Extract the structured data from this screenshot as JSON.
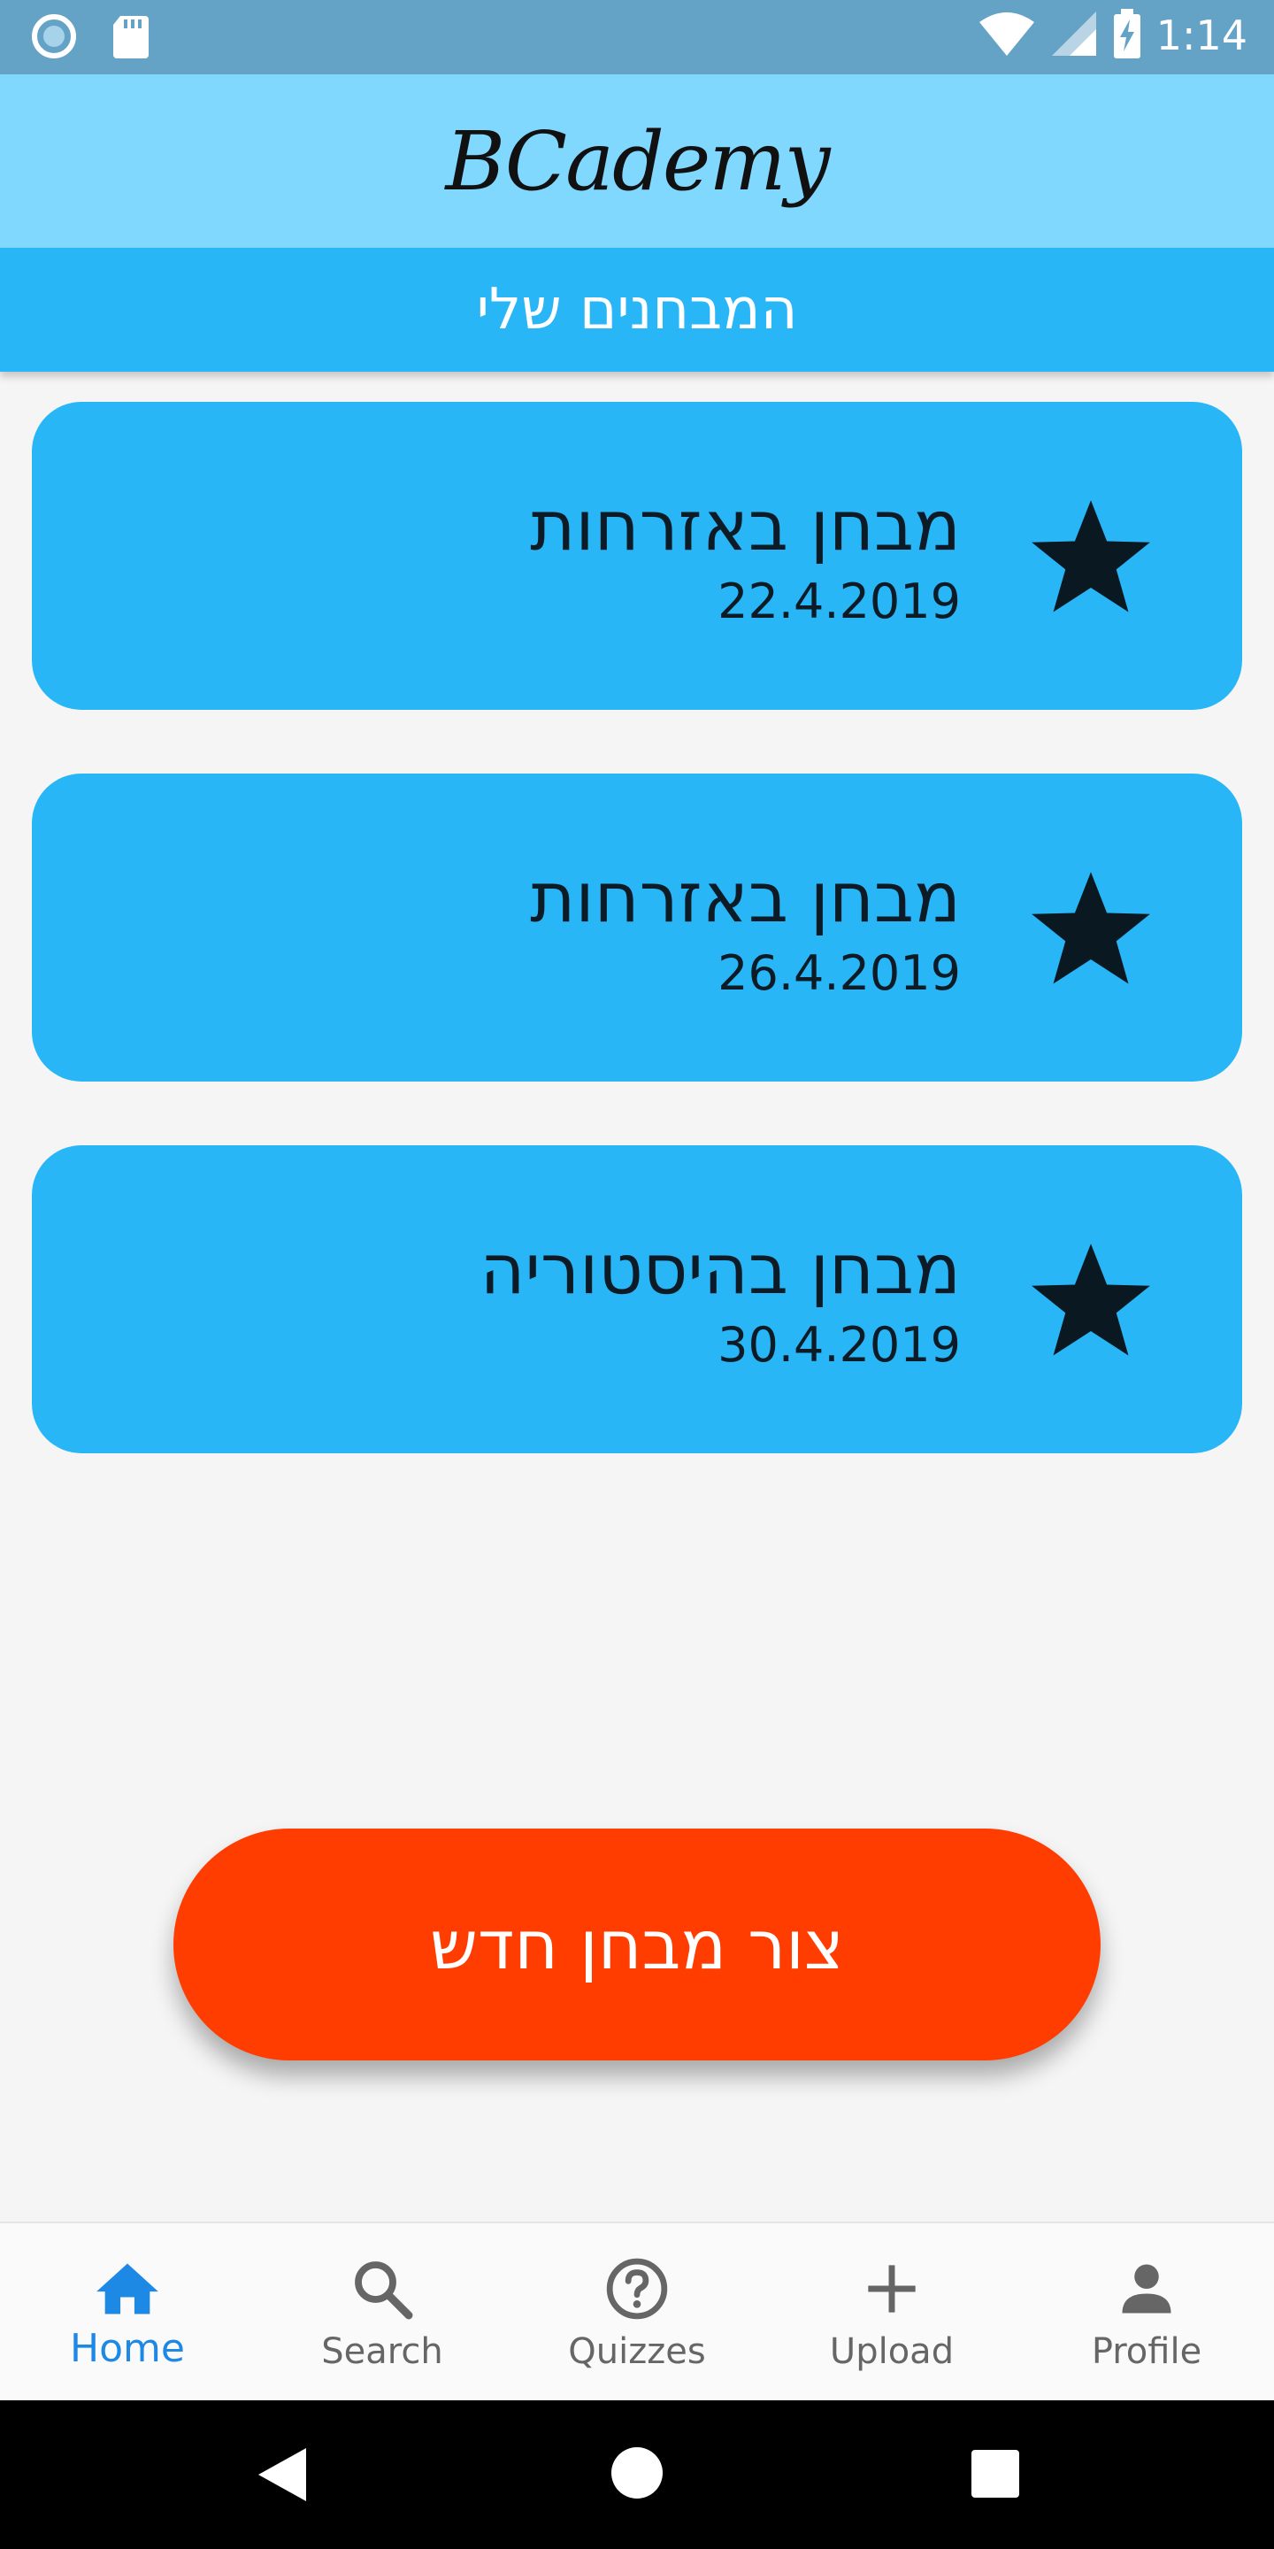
{
  "status_bar": {
    "time": "1:14",
    "icons": [
      "circle-status-icon",
      "sd-card-icon",
      "wifi-icon",
      "signal-icon",
      "battery-charging-icon"
    ]
  },
  "app": {
    "brand": "BCademy"
  },
  "header": {
    "title": "המבחנים שלי"
  },
  "quizzes": [
    {
      "title": "מבחן באזרחות",
      "date": "22.4.2019",
      "icon": "star-icon"
    },
    {
      "title": "מבחן באזרחות",
      "date": "26.4.2019",
      "icon": "star-icon"
    },
    {
      "title": "מבחן בהיסטוריה",
      "date": "30.4.2019",
      "icon": "star-icon"
    }
  ],
  "create_button": {
    "label": "צור מבחן חדש"
  },
  "bottom_nav": {
    "items": [
      {
        "label": "Home",
        "icon": "home-icon",
        "active": true
      },
      {
        "label": "Search",
        "icon": "search-icon",
        "active": false
      },
      {
        "label": "Quizzes",
        "icon": "help-circle-icon",
        "active": false
      },
      {
        "label": "Upload",
        "icon": "plus-icon",
        "active": false
      },
      {
        "label": "Profile",
        "icon": "person-icon",
        "active": false
      }
    ]
  },
  "colors": {
    "status_bar": "#64a3c6",
    "app_bar": "#80d8ff",
    "sub_header": "#29b6f6",
    "card": "#29b6f6",
    "create_button": "#ff3d00",
    "nav_active": "#1e88e5"
  }
}
